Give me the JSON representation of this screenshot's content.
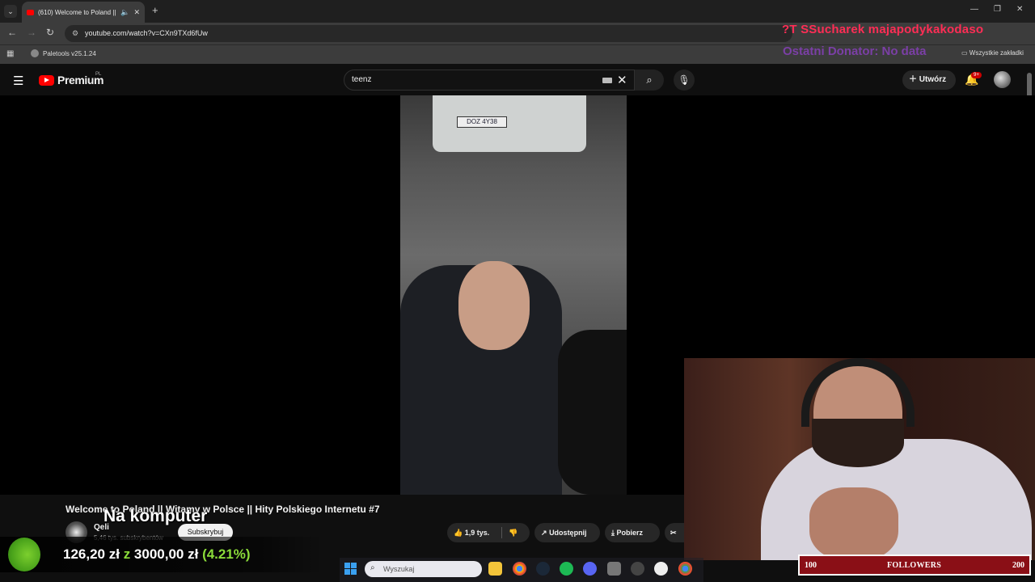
{
  "browser": {
    "tab_title": "(610) Welcome to Poland ||",
    "tab_audio_icon": "speaker-icon",
    "url": "youtube.com/watch?v=CXn9TXd6fUw",
    "bookmark": "Paletools v25.1.24",
    "all_bookmarks": "Wszystkie zakładki"
  },
  "overlay": {
    "ticker": "?T   SSucharek   majapodykakodaso",
    "donator": "Ostatni Donator: No data"
  },
  "youtube": {
    "logo_text": "Premium",
    "logo_region": "PL",
    "search_value": "teenz",
    "create_label": "Utwórz",
    "notifications_badge": "9+"
  },
  "video": {
    "plate": "DOZ 4Y38",
    "title": "Welcome to Poland || Witamy w Polsce || Hity Polskiego Internetu #7",
    "channel_name": "Qeli",
    "channel_subs": "5,46 tys. subskrybentów",
    "subscribe_label": "Subskrybuj",
    "likes": "1,9 tys.",
    "share_label": "Udostępnij",
    "download_label": "Pobierz"
  },
  "stream": {
    "caption": "Na komputer",
    "goal_current": "126,20 zł",
    "goal_sep": "z",
    "goal_target": "3000,00 zł",
    "goal_pct_label": "(4.21%)",
    "goal_fraction": 0.0421,
    "followers_label": "FOLLOWERS",
    "followers_min": "100",
    "followers_max": "200"
  },
  "taskbar": {
    "search_placeholder": "Wyszukaj",
    "apps": [
      "file-explorer-icon",
      "chrome-icon",
      "steam-icon",
      "spotify-icon",
      "discord-icon",
      "app-icon",
      "app-icon-2",
      "app-icon-3",
      "chrome-icon-2"
    ]
  },
  "colors": {
    "accent_red": "#ff0000",
    "goal_green": "#8bdc3a",
    "followers_bg": "#8a0f16"
  }
}
